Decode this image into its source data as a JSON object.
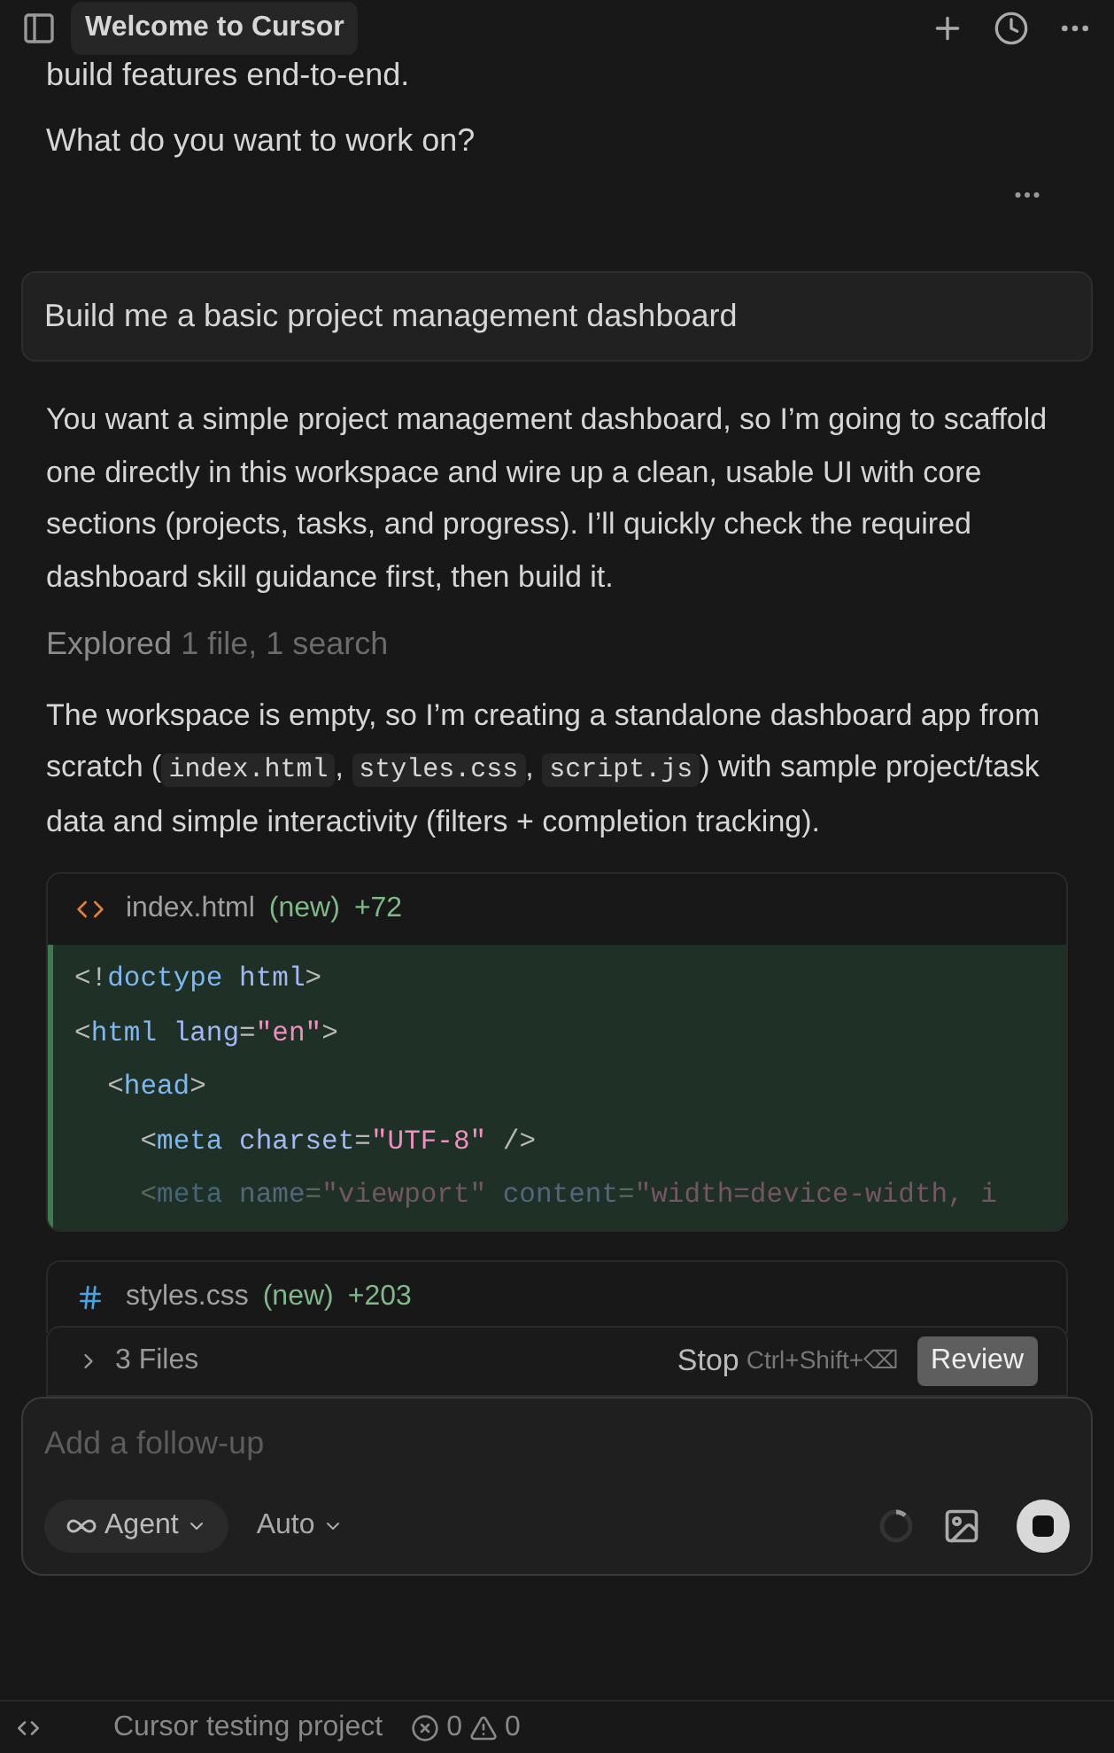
{
  "header": {
    "title": "Welcome to Cursor"
  },
  "intro": [
    "build features end-to-end.",
    "What do you want to work on?"
  ],
  "user_message": "Build me a basic project management dashboard",
  "response": "You want a simple project management dashboard, so I’m going to scaffold one directly in this workspace and wire up a clean, usable UI with core sections (projects, tasks, and progress). I’ll quickly check the required dashboard skill guidance first, then build it.",
  "explored": {
    "label": "Explored",
    "detail": "1 file, 1 search"
  },
  "plan": [
    {
      "kind": "text",
      "text": "The workspace is empty, so I’m creating a standalone dashboard app from scratch ("
    },
    {
      "kind": "code",
      "text": "index.html"
    },
    {
      "kind": "text",
      "text": ", "
    },
    {
      "kind": "code",
      "text": "styles.css"
    },
    {
      "kind": "text",
      "text": ", "
    },
    {
      "kind": "code",
      "text": "script.js"
    },
    {
      "kind": "text",
      "text": ") with sample project/task data and simple interactivity (filters + completion tracking)."
    }
  ],
  "files": [
    {
      "kind": "html",
      "name": "index.html",
      "status": "(new)",
      "added": "+72",
      "lines": [
        [
          {
            "kind": "punct",
            "text": "<!"
          },
          {
            "kind": "tag",
            "text": "doctype"
          },
          {
            "kind": "attr",
            "text": " html"
          },
          {
            "kind": "punct",
            "text": ">"
          }
        ],
        [
          {
            "kind": "punct",
            "text": "<"
          },
          {
            "kind": "tag",
            "text": "html"
          },
          {
            "kind": "attr",
            "text": " lang"
          },
          {
            "kind": "punct",
            "text": "="
          },
          {
            "kind": "string",
            "text": "\"en\""
          },
          {
            "kind": "punct",
            "text": ">"
          }
        ],
        [
          {
            "kind": "punct",
            "text": "  <"
          },
          {
            "kind": "tag",
            "text": "head"
          },
          {
            "kind": "punct",
            "text": ">"
          }
        ],
        [
          {
            "kind": "punct",
            "text": "    <"
          },
          {
            "kind": "tag",
            "text": "meta"
          },
          {
            "kind": "attr",
            "text": " charset"
          },
          {
            "kind": "punct",
            "text": "="
          },
          {
            "kind": "string",
            "text": "\"UTF-8\""
          },
          {
            "kind": "punct",
            "text": " />"
          }
        ],
        [
          {
            "kind": "punct",
            "text": "    <"
          },
          {
            "kind": "tag",
            "text": "meta"
          },
          {
            "kind": "attr",
            "text": " name"
          },
          {
            "kind": "punct",
            "text": "="
          },
          {
            "kind": "string",
            "text": "\"viewport\""
          },
          {
            "kind": "attr",
            "text": " content"
          },
          {
            "kind": "punct",
            "text": "="
          },
          {
            "kind": "string",
            "text": "\"width=device-width, i"
          }
        ]
      ]
    },
    {
      "kind": "css",
      "name": "styles.css",
      "status": "(new)",
      "added": "+203"
    }
  ],
  "files_bar": {
    "label": "3 Files",
    "expanded": false,
    "stop": "Stop",
    "shortcut": "Ctrl+Shift+⌫",
    "review": "Review"
  },
  "composer": {
    "placeholder": "Add a follow-up",
    "mode": "Agent",
    "model": "Auto"
  },
  "status_bar": {
    "project": "Cursor testing project",
    "errors": "0",
    "warnings": "0"
  }
}
